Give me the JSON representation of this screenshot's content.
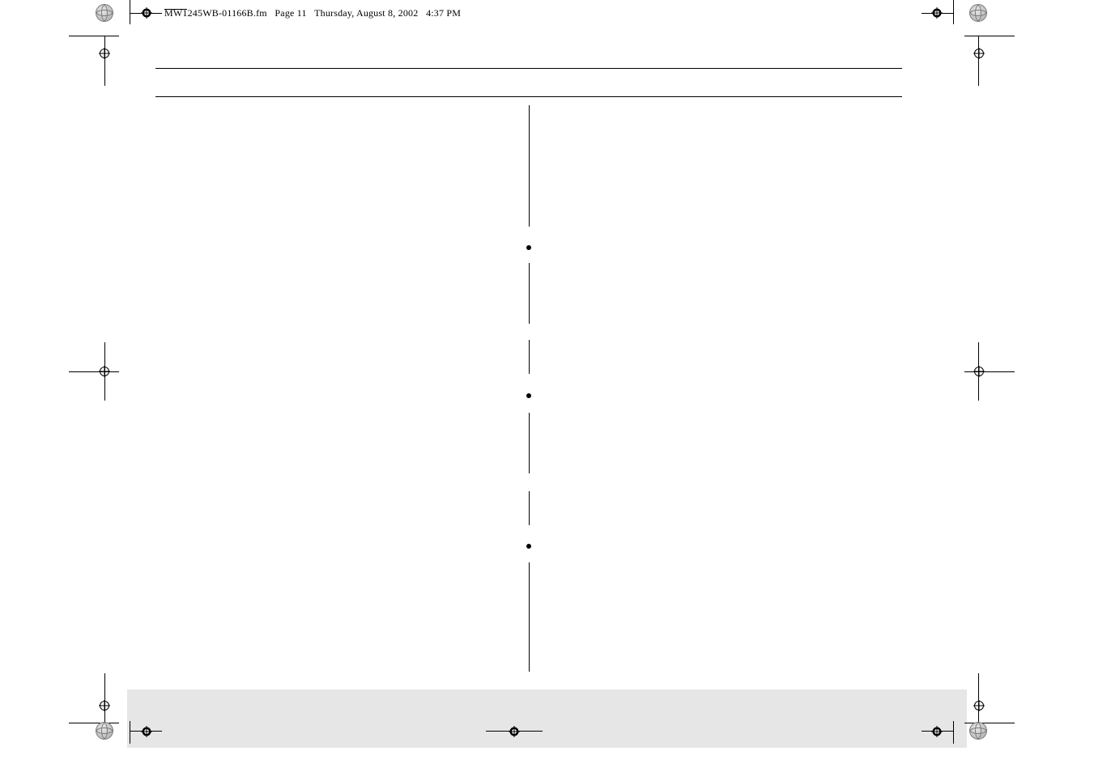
{
  "header": {
    "filename": "MW1245WB-01166B.fm",
    "page_label": "Page 11",
    "date": "Thursday, August 8, 2002",
    "time": "4:37 PM"
  },
  "marks": {
    "bullets": [
      "•",
      "•",
      "•"
    ]
  }
}
